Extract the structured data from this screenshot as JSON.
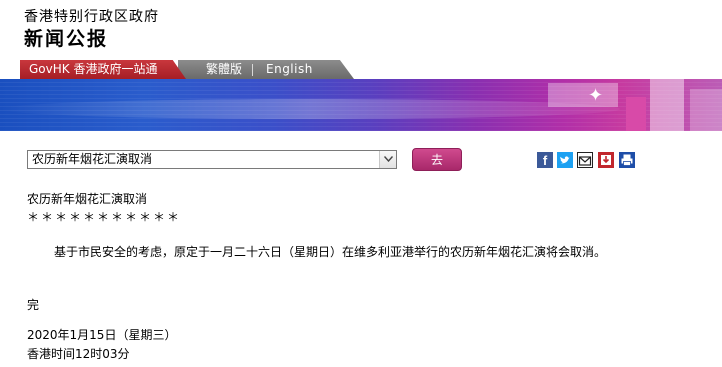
{
  "header": {
    "org_name": "香港特别行政区政府",
    "site_title": "新闻公报"
  },
  "nav": {
    "govhk_label": "GovHK 香港政府一站通",
    "traditional_label": "繁體版",
    "english_label": "English"
  },
  "controls": {
    "selected_item": "农历新年烟花汇演取消",
    "go_label": "去",
    "share_icons": [
      "facebook-icon",
      "twitter-icon",
      "email-icon",
      "download-icon",
      "print-icon"
    ]
  },
  "article": {
    "title": "农历新年烟花汇演取消",
    "stars": "＊＊＊＊＊＊＊＊＊＊＊",
    "body": "基于市民安全的考虑，原定于一月二十六日（星期日）在维多利亚港举行的农历新年烟花汇演将会取消。",
    "end": "完",
    "date": "2020年1月15日（星期三）",
    "time": "香港时间12时03分"
  },
  "colors": {
    "gov_red": "#b3262d",
    "nav_gray": "#7a7a7a",
    "go_button": "#bd3a7e",
    "banner_blue": "#2a5ccc",
    "banner_purple": "#b12fa8"
  }
}
